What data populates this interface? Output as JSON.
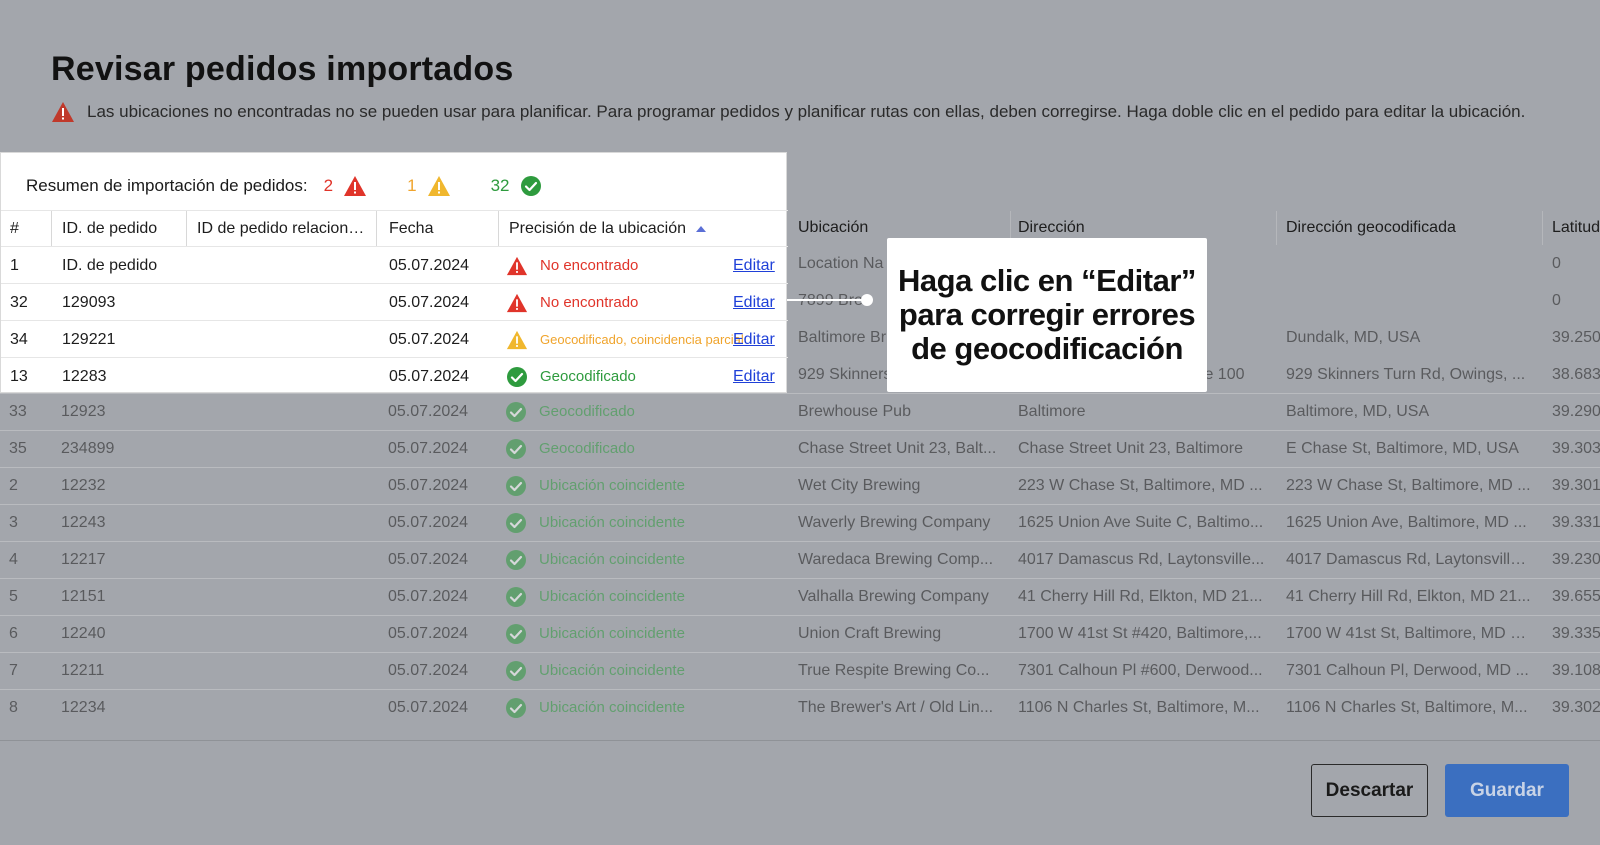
{
  "title": "Revisar pedidos importados",
  "notice": "Las ubicaciones no encontradas no se pueden usar para planificar. Para programar pedidos y planificar rutas con ellas, deben corregirse. Haga doble clic en el pedido para editar la ubicación.",
  "summary": {
    "label": "Resumen de importación de pedidos:",
    "errors": "2",
    "warnings": "1",
    "ok": "32"
  },
  "columns": {
    "num": "#",
    "id": "ID. de pedido",
    "related": "ID de pedido relacionado",
    "date": "Fecha",
    "precision": "Precisión de la ubicación",
    "location": "Ubicación",
    "address": "Dirección",
    "geo_address": "Dirección geocodificada",
    "lat": "Latitud"
  },
  "edit_label": "Editar",
  "highlight_rows": [
    {
      "num": "1",
      "id": "ID. de pedido",
      "date": "05.07.2024",
      "status": "No encontrado",
      "level": "error",
      "location": "Location Na",
      "lat": "0"
    },
    {
      "num": "32",
      "id": "129093",
      "date": "05.07.2024",
      "status": "No encontrado",
      "level": "error",
      "location": "7899 Bre",
      "lat": "0"
    },
    {
      "num": "34",
      "id": "129221",
      "date": "05.07.2024",
      "status": "Geocodificado, coincidencia parcial",
      "level": "warning",
      "location": "Baltimore Br",
      "geo_address": "Dundalk, MD, USA",
      "lat": "39.250"
    },
    {
      "num": "13",
      "id": "12283",
      "date": "05.07.2024",
      "status": "Geocodificado",
      "level": "ok",
      "location": "929 Skinners",
      "address": "te 100",
      "geo_address": "929 Skinners Turn Rd, Owings, ...",
      "lat": "38.683"
    }
  ],
  "rows": [
    {
      "num": "33",
      "id": "12923",
      "date": "05.07.2024",
      "status": "Geocodificado",
      "location": "Brewhouse Pub",
      "address": "Baltimore",
      "geo_address": "Baltimore, MD, USA",
      "lat": "39.290"
    },
    {
      "num": "35",
      "id": "234899",
      "date": "05.07.2024",
      "status": "Geocodificado",
      "location": "Chase Street Unit 23, Balt...",
      "address": "Chase Street Unit 23, Baltimore",
      "geo_address": "E Chase St, Baltimore, MD, USA",
      "lat": "39.303"
    },
    {
      "num": "2",
      "id": "12232",
      "date": "05.07.2024",
      "status": "Ubicación coincidente",
      "location": "Wet City Brewing",
      "address": "223 W Chase St, Baltimore, MD ...",
      "geo_address": "223 W Chase St, Baltimore, MD ...",
      "lat": "39.301"
    },
    {
      "num": "3",
      "id": "12243",
      "date": "05.07.2024",
      "status": "Ubicación coincidente",
      "location": "Waverly Brewing Company",
      "address": "1625 Union Ave Suite C, Baltimo...",
      "geo_address": "1625 Union Ave, Baltimore, MD ...",
      "lat": "39.331"
    },
    {
      "num": "4",
      "id": "12217",
      "date": "05.07.2024",
      "status": "Ubicación coincidente",
      "location": "Waredaca Brewing Comp...",
      "address": "4017 Damascus Rd, Laytonsville...",
      "geo_address": "4017 Damascus Rd, Laytonsville...",
      "lat": "39.230"
    },
    {
      "num": "5",
      "id": "12151",
      "date": "05.07.2024",
      "status": "Ubicación coincidente",
      "location": "Valhalla Brewing Company",
      "address": "41 Cherry Hill Rd, Elkton, MD 21...",
      "geo_address": "41 Cherry Hill Rd, Elkton, MD 21...",
      "lat": "39.655"
    },
    {
      "num": "6",
      "id": "12240",
      "date": "05.07.2024",
      "status": "Ubicación coincidente",
      "location": "Union Craft Brewing",
      "address": "1700 W 41st St #420, Baltimore,...",
      "geo_address": "1700 W 41st St, Baltimore, MD 2...",
      "lat": "39.335"
    },
    {
      "num": "7",
      "id": "12211",
      "date": "05.07.2024",
      "status": "Ubicación coincidente",
      "location": "True Respite Brewing Co...",
      "address": "7301 Calhoun Pl #600, Derwood...",
      "geo_address": "7301 Calhoun Pl, Derwood, MD ...",
      "lat": "39.108"
    },
    {
      "num": "8",
      "id": "12234",
      "date": "05.07.2024",
      "status": "Ubicación coincidente",
      "location": "The Brewer's Art / Old Lin...",
      "address": "1106 N Charles St, Baltimore, M...",
      "geo_address": "1106 N Charles St, Baltimore, M...",
      "lat": "39.302"
    }
  ],
  "callout": "Haga clic en “Editar” para corregir errores de geocodificación",
  "buttons": {
    "discard": "Descartar",
    "save": "Guardar"
  },
  "colors": {
    "error": "#e0342a",
    "warning": "#f0a42c",
    "ok": "#2e9b3e",
    "link": "#1f40d8",
    "primary": "#3b6fc0"
  }
}
